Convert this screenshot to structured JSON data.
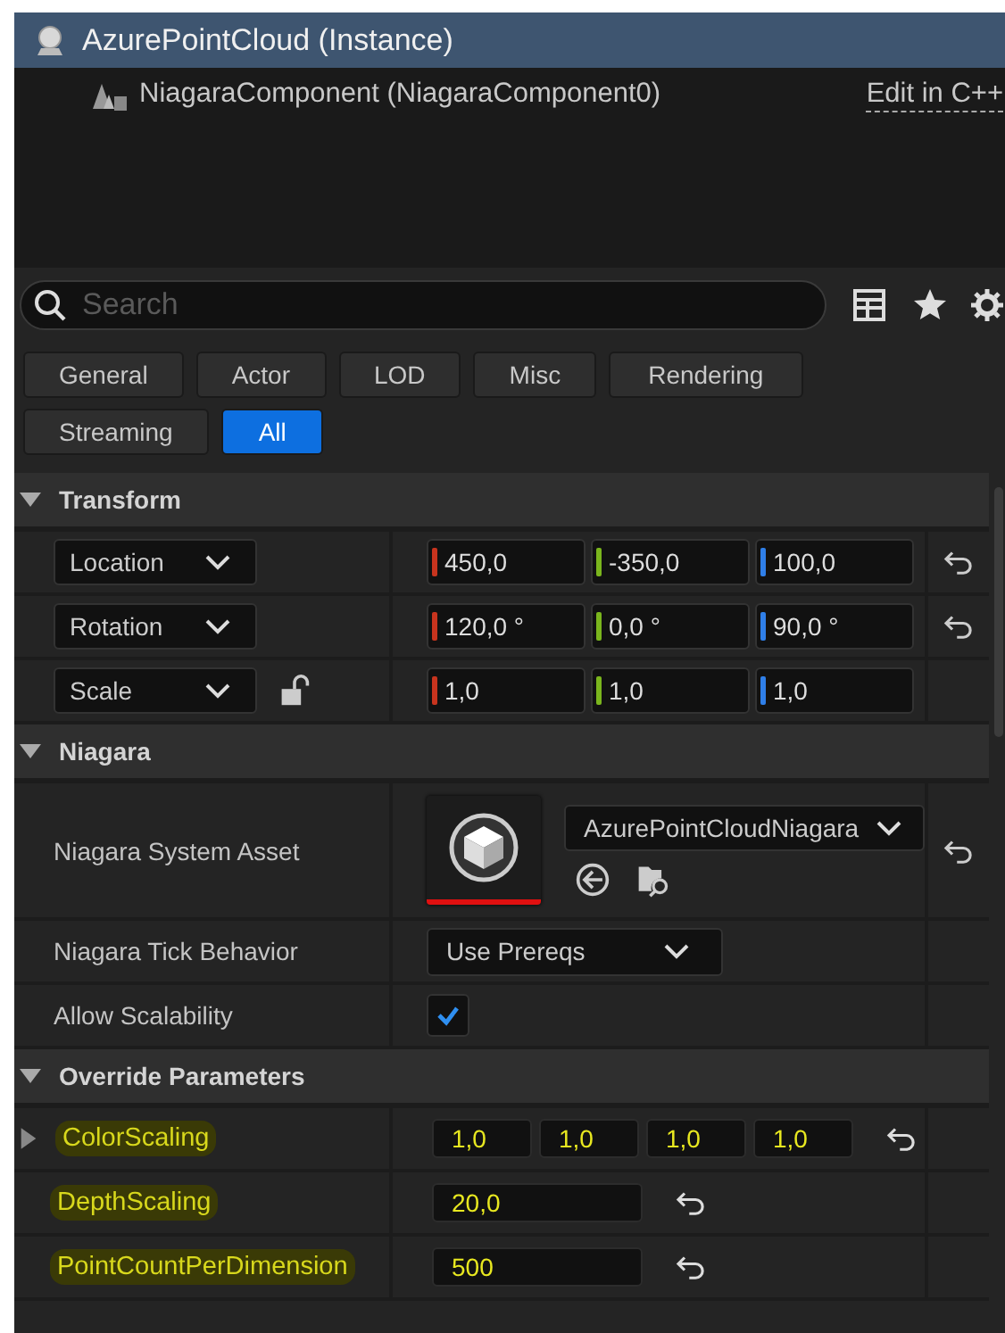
{
  "header": {
    "title": "AzurePointCloud (Instance)",
    "component": "NiagaraComponent (NiagaraComponent0)",
    "edit_link": "Edit in C++"
  },
  "search": {
    "placeholder": "Search"
  },
  "filters": [
    {
      "label": "General",
      "selected": false
    },
    {
      "label": "Actor",
      "selected": false
    },
    {
      "label": "LOD",
      "selected": false
    },
    {
      "label": "Misc",
      "selected": false
    },
    {
      "label": "Rendering",
      "selected": false
    },
    {
      "label": "Streaming",
      "selected": false
    },
    {
      "label": "All",
      "selected": true
    }
  ],
  "sections": [
    {
      "title": "Transform",
      "expanded": true,
      "rows": [
        {
          "kind": "vector",
          "label": "Location",
          "values": [
            "450,0",
            "-350,0",
            "100,0"
          ],
          "lock": false,
          "reset": true
        },
        {
          "kind": "vector",
          "label": "Rotation",
          "values": [
            "120,0 °",
            "0,0 °",
            "90,0 °"
          ],
          "lock": false,
          "reset": true
        },
        {
          "kind": "vector",
          "label": "Scale",
          "values": [
            "1,0",
            "1,0",
            "1,0"
          ],
          "lock": true,
          "reset": false
        }
      ]
    },
    {
      "title": "Niagara",
      "expanded": true,
      "rows": [
        {
          "kind": "asset",
          "label": "Niagara System Asset",
          "value": "AzurePointCloudNiagara",
          "reset": true
        },
        {
          "kind": "dropdown",
          "label": "Niagara Tick Behavior",
          "value": "Use Prereqs",
          "reset": false
        },
        {
          "kind": "checkbox",
          "label": "Allow Scalability",
          "checked": true,
          "reset": false
        }
      ]
    },
    {
      "title": "Override Parameters",
      "expanded": true,
      "rows": [
        {
          "kind": "param",
          "label": "ColorScaling",
          "expanded": false,
          "highlighted": true,
          "values": [
            "1,0",
            "1,0",
            "1,0",
            "1,0"
          ],
          "reset": true
        },
        {
          "kind": "param",
          "label": "DepthScaling",
          "highlighted": true,
          "values": [
            "20,0"
          ],
          "reset": true
        },
        {
          "kind": "param",
          "label": "PointCountPerDimension",
          "highlighted": true,
          "values": [
            "500"
          ],
          "reset": true
        }
      ]
    }
  ]
}
